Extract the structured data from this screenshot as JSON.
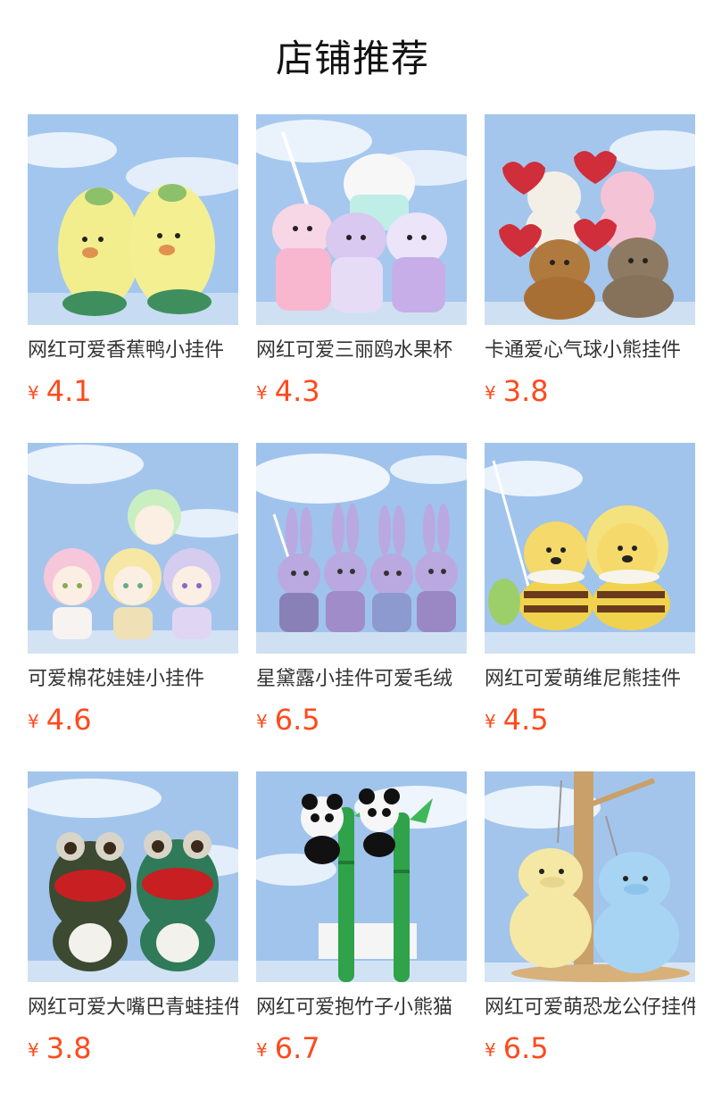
{
  "section": {
    "title": "店铺推荐"
  },
  "products": [
    {
      "name": "网红可爱香蕉鸭小挂件",
      "currency": "¥",
      "price": "4.1",
      "icon": "banana-duck-plush"
    },
    {
      "name": "网红可爱三丽鸥水果杯",
      "currency": "¥",
      "price": "4.3",
      "icon": "sanrio-fruit-cup-plush"
    },
    {
      "name": "卡通爱心气球小熊挂件",
      "currency": "¥",
      "price": "3.8",
      "icon": "heart-balloon-bear-plush"
    },
    {
      "name": "可爱棉花娃娃小挂件",
      "currency": "¥",
      "price": "4.6",
      "icon": "cotton-doll-plush"
    },
    {
      "name": "星黛露小挂件可爱毛绒",
      "currency": "¥",
      "price": "6.5",
      "icon": "stellalou-bunny-plush"
    },
    {
      "name": "网红可爱萌维尼熊挂件",
      "currency": "¥",
      "price": "4.5",
      "icon": "winnie-bear-plush"
    },
    {
      "name": "网红可爱大嘴巴青蛙挂件",
      "currency": "¥",
      "price": "3.8",
      "icon": "big-mouth-frog-plush"
    },
    {
      "name": "网红可爱抱竹子小熊猫",
      "currency": "¥",
      "price": "6.7",
      "icon": "bamboo-panda-plush"
    },
    {
      "name": "网红可爱萌恐龙公仔挂件",
      "currency": "¥",
      "price": "6.5",
      "icon": "dinosaur-plush"
    }
  ]
}
